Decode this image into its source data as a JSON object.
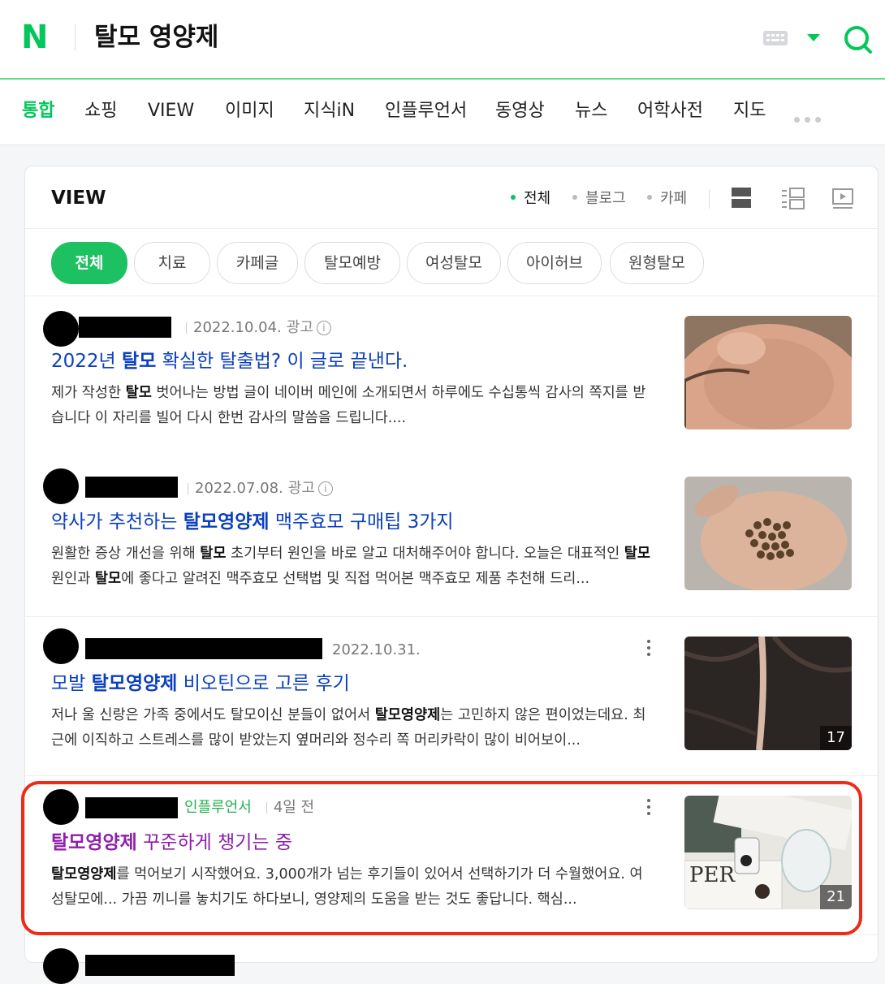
{
  "header": {
    "logo": "N",
    "query": "탈모 영양제",
    "keyboard_icon": "keyboard-icon",
    "search_icon": "search-icon"
  },
  "tabs": [
    {
      "label": "통합",
      "active": true
    },
    {
      "label": "쇼핑"
    },
    {
      "label": "VIEW"
    },
    {
      "label": "이미지"
    },
    {
      "label": "지식iN"
    },
    {
      "label": "인플루언서"
    },
    {
      "label": "동영상"
    },
    {
      "label": "뉴스"
    },
    {
      "label": "어학사전"
    },
    {
      "label": "지도"
    }
  ],
  "view": {
    "title": "VIEW",
    "filters": [
      "전체",
      "블로그",
      "카페"
    ],
    "chips": [
      "전체",
      "치료",
      "카페글",
      "탈모예방",
      "여성탈모",
      "아이허브",
      "원형탈모"
    ]
  },
  "results": [
    {
      "date": "2022.10.04.",
      "ad": "광고",
      "title_pre": "2022년 ",
      "title_bold": "탈모",
      "title_post": " 확실한 탈출법? 이 글로 끝낸다.",
      "desc_1": "제가 작성한 ",
      "desc_b1": "탈모",
      "desc_2": " 벗어나는 방법 글이 네이버 메인에 소개되면서 하루에도 수십통씩 감사의 쪽지를 받습니다 이 자리를 빌어 다시 한번 감사의 말씀을 드립니다...."
    },
    {
      "date": "2022.07.08.",
      "ad": "광고",
      "title_pre": "약사가 추천하는 ",
      "title_bold": "탈모영양제",
      "title_post": " 맥주효모 구매팁 3가지",
      "desc_1": "원활한 증상 개선을 위해 ",
      "desc_b1": "탈모",
      "desc_2": " 초기부터 원인을 바로 알고 대처해주어야 합니다. 오늘은 대표적인 ",
      "desc_b2": "탈모",
      "desc_3": " 원인과 ",
      "desc_b3": "탈모",
      "desc_4": "에 좋다고 알려진 맥주효모 선택법 및 직접 먹어본 맥주효모 제품 추천해 드리..."
    },
    {
      "date": "2022.10.31.",
      "title_pre": "모발 ",
      "title_bold": "탈모영양제",
      "title_post": " 비오틴으로 고른 후기",
      "desc_1": "저나 울 신랑은 가족 중에서도 탈모이신 분들이 없어서 ",
      "desc_b1": "탈모영양제",
      "desc_2": "는 고민하지 않은 편이었는데요. 최근에 이직하고 스트레스를 많이 받았는지 옆머리와 정수리 쪽 머리카락이 많이 비어보이...",
      "image_count": "17"
    },
    {
      "badge": "인플루언서",
      "date": "4일 전",
      "title_bold": "탈모영양제",
      "title_post": " 꾸준하게 챙기는 중",
      "desc_b1": "탈모영양제",
      "desc_2": "를 먹어보기 시작했어요. 3,000개가 넘는 후기들이 있어서 선택하기가 더 수월했어요. 여성탈모에... 가끔 끼니를 놓치기도 하다보니, 영양제의 도움을 받는 것도 좋답니다. 핵심...",
      "image_count": "21",
      "thumb_text": "PER"
    }
  ]
}
